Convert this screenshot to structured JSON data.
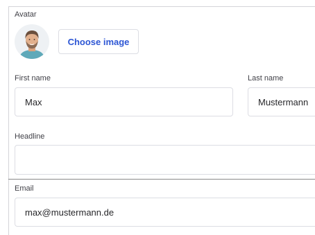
{
  "form": {
    "avatar_label": "Avatar",
    "choose_image_label": "Choose image",
    "first_name_label": "First name",
    "first_name_value": "Max",
    "last_name_label": "Last name",
    "last_name_value": "Mustermann",
    "headline_label": "Headline",
    "headline_value": "",
    "email_label": "Email",
    "email_value": "max@mustermann.de"
  },
  "colors": {
    "accent": "#2d56d4",
    "border": "#dcdde3"
  },
  "icons": {
    "avatar": "user-avatar-photo"
  }
}
